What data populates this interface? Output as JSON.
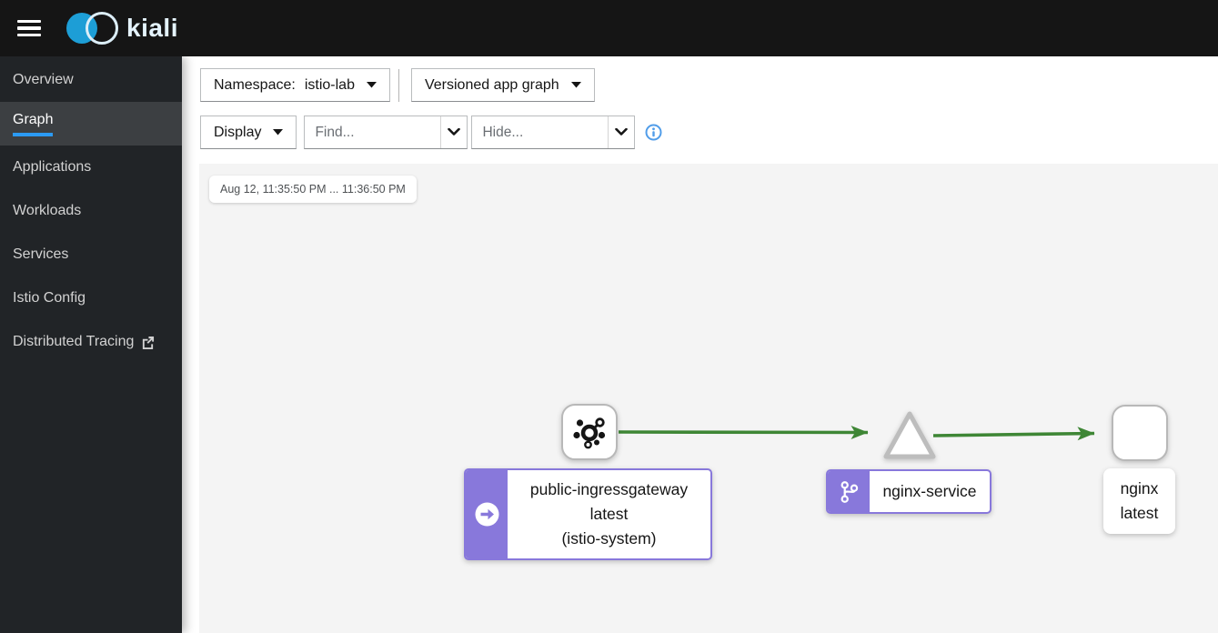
{
  "masthead": {
    "brand": "kiali"
  },
  "sidebar": {
    "items": [
      {
        "label": "Overview",
        "selected": false
      },
      {
        "label": "Graph",
        "selected": true
      },
      {
        "label": "Applications",
        "selected": false
      },
      {
        "label": "Workloads",
        "selected": false
      },
      {
        "label": "Services",
        "selected": false
      },
      {
        "label": "Istio Config",
        "selected": false
      },
      {
        "label": "Distributed Tracing",
        "selected": false,
        "external": true
      }
    ]
  },
  "toolbar": {
    "namespace_label": "Namespace:",
    "namespace_value": "istio-lab",
    "graph_type": "Versioned app graph",
    "display_label": "Display",
    "find_placeholder": "Find...",
    "hide_placeholder": "Hide..."
  },
  "graph": {
    "time_range": "Aug 12, 11:35:50 PM ... 11:36:50 PM",
    "edge_color": "#3e8635",
    "node_border_color": "#b8b8b8",
    "app_accent_color": "#8878db",
    "selected_tab_color": "#2b9af3",
    "nodes": [
      {
        "id": "public-ingressgateway",
        "type": "app-versioned",
        "icon": "gateway-hub-icon",
        "badge": "arrow-right-circle",
        "lines": [
          "public-ingressgateway",
          "latest",
          "(istio-system)"
        ]
      },
      {
        "id": "nginx-service",
        "type": "service",
        "icon": "triangle",
        "badge": "git-branch",
        "lines": [
          "nginx-service"
        ]
      },
      {
        "id": "nginx",
        "type": "app-versioned",
        "icon": "none",
        "badge": "none",
        "lines": [
          "nginx",
          "latest"
        ]
      }
    ],
    "edges": [
      {
        "from": "public-ingressgateway",
        "to": "nginx-service",
        "status": "healthy"
      },
      {
        "from": "nginx-service",
        "to": "nginx",
        "status": "healthy"
      }
    ]
  }
}
